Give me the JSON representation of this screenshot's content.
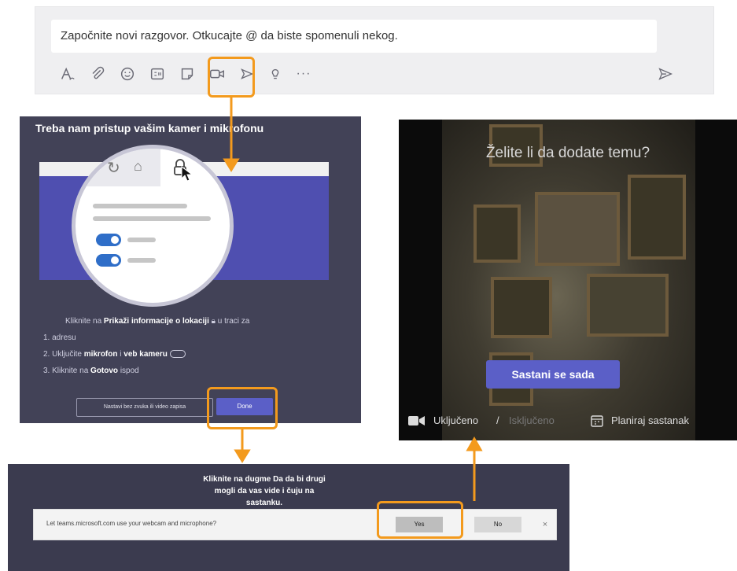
{
  "compose": {
    "placeholder": "Započnite novi razgovor. Otkucajte @ da biste spomenuli nekog.",
    "tools": [
      "format-icon",
      "attach-icon",
      "emoji-icon",
      "gif-icon",
      "sticker-icon",
      "meet-now-video-icon",
      "share-icon",
      "praise-icon",
      "more-icon",
      "send-icon"
    ],
    "more_label": "···"
  },
  "permission": {
    "title": "Treba nam pristup vašim kamer i mikrofonu",
    "step1_prefix": "Kliknite na",
    "step1_bold": "Prikaži informacije o lokaciji",
    "step1_suffix": "u traci za",
    "step1_cont": "adresu",
    "step2_prefix": "Uključite",
    "step2_bold1": "mikrofon",
    "step2_mid": "i",
    "step2_bold2": "veb kameru",
    "step3_prefix": "Kliknite na",
    "step3_bold": "Gotovo",
    "step3_suffix": "ispod",
    "skip_label": "Nastavi bez zvuka ili video zapisa",
    "done_label": "Done"
  },
  "meet": {
    "question": "Želite li da dodate temu?",
    "meet_now_label": "Sastani se sada",
    "video_on_label": "Uključeno",
    "separator": "/",
    "video_off_label": "Isključeno",
    "schedule_label": "Planiraj sastanak"
  },
  "confirm": {
    "title_line1": "Kliknite na dugme Da da bi drugi",
    "title_line2": "mogli da vas vide i čuju na",
    "title_line3": "sastanku.",
    "prompt": "Let teams.microsoft.com use your webcam and microphone?",
    "yes_label": "Yes",
    "no_label": "No",
    "close_label": "×"
  },
  "colors": {
    "accent_orange": "#f39a1d",
    "teams_purple": "#5b5fc7",
    "panel_dark": "#424257"
  }
}
